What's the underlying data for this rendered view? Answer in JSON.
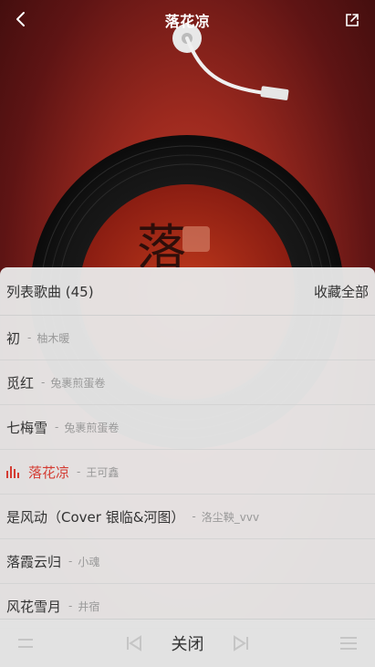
{
  "header": {
    "title": "落花凉"
  },
  "playlist": {
    "title": "列表歌曲 (45)",
    "collect_all": "收藏全部",
    "songs": [
      {
        "name": "初",
        "sep": "-",
        "artist": "柚木暖"
      },
      {
        "name": "觅红",
        "sep": "-",
        "artist": "兔裹煎蛋卷"
      },
      {
        "name": "七梅雪",
        "sep": "-",
        "artist": "兔裹煎蛋卷"
      },
      {
        "name": "落花凉",
        "sep": "-",
        "artist": "王可鑫",
        "active": true
      },
      {
        "name": "是风动（Cover 银临&河图）",
        "sep": "-",
        "artist": "洛尘鞅_vvv"
      },
      {
        "name": "落霞云归",
        "sep": "-",
        "artist": "小魂"
      },
      {
        "name": "风花雪月",
        "sep": "-",
        "artist": "井宿"
      }
    ],
    "close_label": "关闭"
  },
  "colors": {
    "accent": "#d43c33",
    "text": "#333333",
    "muted": "#999999"
  },
  "icons": {
    "back": "chevron-left-icon",
    "share": "share-icon",
    "playing": "equalizer-icon"
  }
}
